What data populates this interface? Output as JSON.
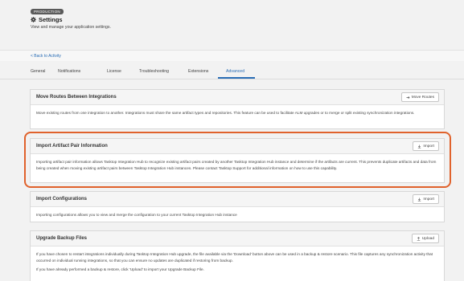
{
  "header": {
    "environment_badge": "PRODUCTION",
    "title": "Settings",
    "subtitle": "View and manage your application settings."
  },
  "nav": {
    "back_link": "< Back to Activity"
  },
  "tabs": [
    {
      "label": "General"
    },
    {
      "label": "Notifications"
    },
    {
      "label": "License"
    },
    {
      "label": "Troubleshooting"
    },
    {
      "label": "Extensions"
    },
    {
      "label": "Advanced",
      "active": true
    }
  ],
  "cards": {
    "move_routes": {
      "title": "Move Routes Between Integrations",
      "button": "Move Routes",
      "body": "Move existing routes from one integration to another. Integrations must share the same artifact types and repositories. This feature can be used to facilitate ALM upgrades or to merge or split existing synchronization integrations."
    },
    "import_artifact_pair": {
      "title": "Import Artifact Pair Information",
      "button": "Import",
      "body": "Importing artifact pair information allows Tasktop Integration Hub to recognize existing artifact pairs created by another Tasktop Integration Hub instance and determine if the artifacts are current. This prevents duplicate artifacts and data from being created when moving existing artifact pairs between Tasktop Integration Hub instances. Please contact Tasktop Support for additional information on how to use this capability."
    },
    "import_configurations": {
      "title": "Import Configurations",
      "button": "Import",
      "body": "Importing configurations allows you to view and merge the configuration to your current Tasktop Integration Hub instance"
    },
    "upgrade_backup": {
      "title": "Upgrade Backup Files",
      "button": "Upload",
      "body_1": "If you have chosen to restart integrations individually during Tasktop Integration Hub upgrade, the file available via the 'Download' button above can be used in a backup & restore scenario. This file captures any synchronization activity that occurred on individual running integrations, so that you can ensure no updates are duplicated if restoring from backup.",
      "body_2": "If you have already performed a backup & restore, click 'Upload' to import your Upgrade Backup File."
    }
  },
  "colors": {
    "accent": "#2a6db5",
    "highlight": "#e0622c"
  }
}
